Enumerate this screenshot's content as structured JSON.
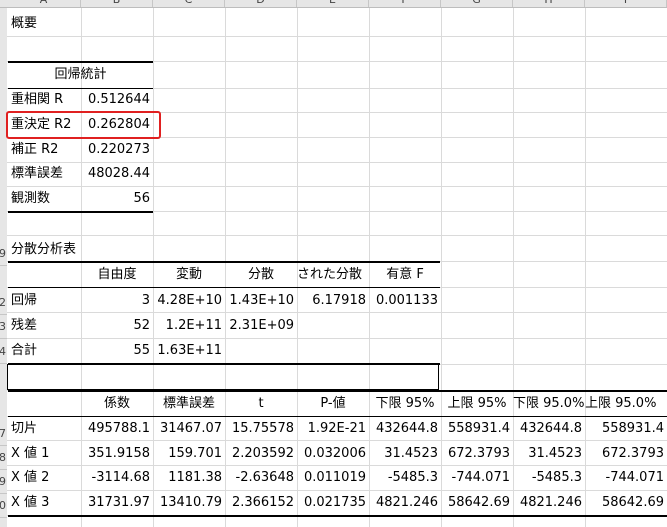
{
  "columns": [
    "A",
    "B",
    "C",
    "D",
    "E",
    "F",
    "G",
    "H",
    "I"
  ],
  "rows": [
    "",
    "",
    "",
    "",
    "",
    "",
    "",
    "",
    "",
    "9",
    "",
    "2",
    "3",
    "4",
    "",
    "",
    "7",
    "8",
    "9",
    "0"
  ],
  "summary": {
    "title": "概要"
  },
  "regression_stats": {
    "header": "回帰統計",
    "rows": [
      {
        "label": "重相関 R",
        "value": "0.512644"
      },
      {
        "label": "重決定 R2",
        "value": "0.262804"
      },
      {
        "label": "補正 R2",
        "value": "0.220273"
      },
      {
        "label": "標準誤差",
        "value": "48028.44"
      },
      {
        "label": "観測数",
        "value": "56"
      }
    ]
  },
  "anova": {
    "title": "分散分析表",
    "headers": [
      "",
      "自由度",
      "変動",
      "分散",
      "された分散",
      "有意 F"
    ],
    "rows": [
      [
        "回帰",
        "3",
        "4.28E+10",
        "1.43E+10",
        "6.17918",
        "0.001133"
      ],
      [
        "残差",
        "52",
        "1.2E+11",
        "2.31E+09",
        "",
        ""
      ],
      [
        "合計",
        "55",
        "1.63E+11",
        "",
        "",
        ""
      ]
    ]
  },
  "coefficients": {
    "headers": [
      "",
      "係数",
      "標準誤差",
      "t",
      "P-値",
      "下限 95%",
      "上限 95%",
      "下限 95.0%",
      "上限 95.0%"
    ],
    "rows": [
      [
        "切片",
        "495788.1",
        "31467.07",
        "15.75578",
        "1.92E-21",
        "432644.8",
        "558931.4",
        "432644.8",
        "558931.4"
      ],
      [
        "X 値 1",
        "351.9158",
        "159.701",
        "2.203592",
        "0.032006",
        "31.4523",
        "672.3793",
        "31.4523",
        "672.3793"
      ],
      [
        "X 値 2",
        "-3114.68",
        "1181.38",
        "-2.63648",
        "0.011019",
        "-5485.3",
        "-744.071",
        "-5485.3",
        "-744.071"
      ],
      [
        "X 値 3",
        "31731.97",
        "13410.79",
        "2.366152",
        "0.021735",
        "4821.246",
        "58642.69",
        "4821.246",
        "58642.69"
      ]
    ]
  }
}
